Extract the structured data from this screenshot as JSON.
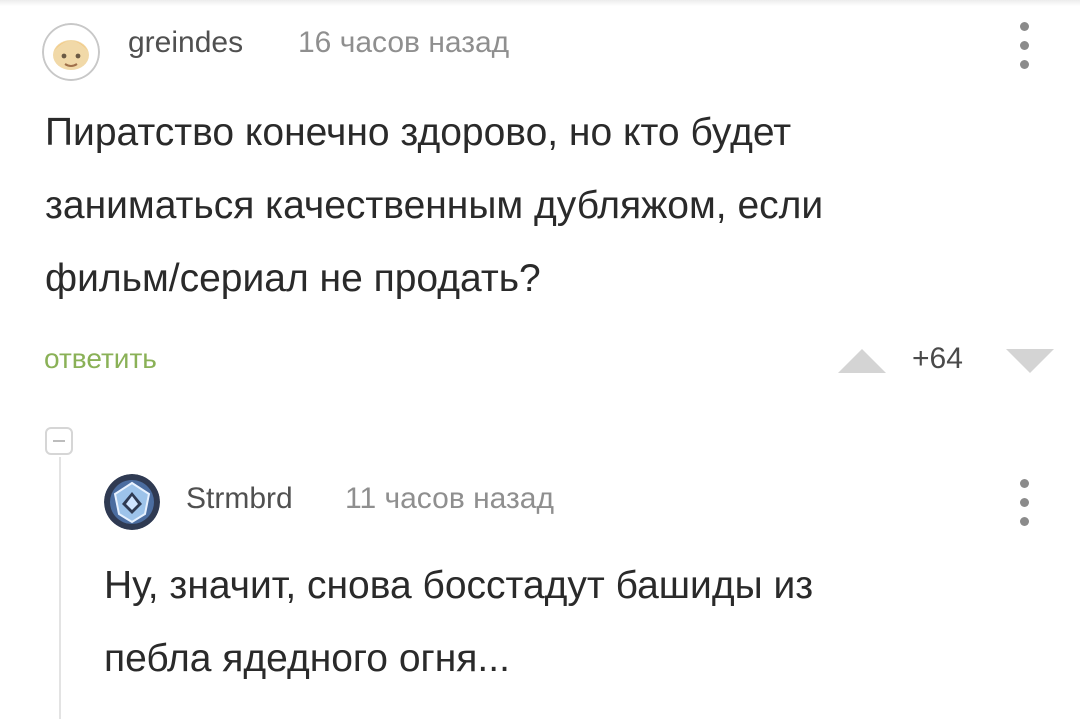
{
  "comments": [
    {
      "username": "greindes",
      "time": "16 часов назад",
      "lines": [
        "Пиратство конечно здорово, но кто будет",
        "заниматься качественным дубляжом, если",
        "фильм/сериал не продать?"
      ],
      "reply_label": "ответить",
      "rating": "+64"
    },
    {
      "username": "Strmbrd",
      "time": "11 часов назад",
      "lines": [
        "Ну, значит, снова босстадут башиды из",
        "пебла ядедного огня..."
      ]
    }
  ],
  "icons": {
    "more": "more-vertical-icon",
    "upvote": "upvote-triangle-icon",
    "downvote": "downvote-triangle-icon",
    "collapse": "collapse-thread-icon"
  },
  "colors": {
    "reply": "#8ab157",
    "username": "#505050",
    "time": "#8f8f8f",
    "text": "#2a2a2a",
    "vote_arrow": "#d4d4d4"
  }
}
